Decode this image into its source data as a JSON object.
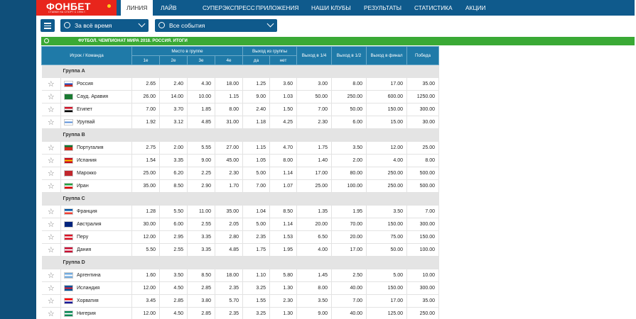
{
  "logo": {
    "text": "ФОНБЕТ",
    "tagline": "СТАВКИ НА СПОРТ С 1994 Г."
  },
  "nav": [
    "ЛИНИЯ",
    "ЛАЙВ",
    "СУПЕРЭКСПРЕСС",
    "ПРИЛОЖЕНИЯ",
    "НАШИ КЛУБЫ",
    "РЕЗУЛЬТАТЫ",
    "СТАТИСТИКА",
    "АКЦИИ"
  ],
  "filters": {
    "period": "За всё время",
    "events": "Все события"
  },
  "tournament": "ФУТБОЛ. ЧЕМПИОНАТ МИРА 2018. РОССИЯ. ИТОГИ",
  "table": {
    "headers": {
      "team": "Игрок / Команда",
      "place": "Место в группе",
      "place_cols": [
        "1е",
        "2е",
        "3е",
        "4е"
      ],
      "exit": "Выход из группы",
      "exit_cols": [
        "да",
        "нет"
      ],
      "q14": "Выход в 1/4",
      "q12": "Выход в 1/2",
      "final": "Выход в финал",
      "win": "Победа"
    },
    "groups": [
      {
        "name": "Группа A",
        "teams": [
          {
            "name": "Россия",
            "flag": [
              "#ffffff",
              "#1b4fc4",
              "#d52b1e"
            ],
            "odds": [
              "2.65",
              "2.40",
              "4.30",
              "18.00",
              "1.25",
              "3.60",
              "3.00",
              "8.00",
              "17.00",
              "35.00"
            ]
          },
          {
            "name": "Сауд. Аравия",
            "flag": [
              "#1a7a32",
              "#1a7a32",
              "#1a7a32"
            ],
            "odds": [
              "26.00",
              "14.00",
              "10.00",
              "1.15",
              "9.00",
              "1.03",
              "50.00",
              "250.00",
              "600.00",
              "1250.00"
            ]
          },
          {
            "name": "Египет",
            "flag": [
              "#ce1126",
              "#ffffff",
              "#000000"
            ],
            "odds": [
              "7.00",
              "3.70",
              "1.85",
              "8.00",
              "2.40",
              "1.50",
              "7.00",
              "50.00",
              "150.00",
              "300.00"
            ]
          },
          {
            "name": "Уругвай",
            "flag": [
              "#ffffff",
              "#5a8fd8",
              "#ffffff"
            ],
            "odds": [
              "1.92",
              "3.12",
              "4.85",
              "31.00",
              "1.18",
              "4.25",
              "2.30",
              "6.00",
              "15.00",
              "30.00"
            ]
          }
        ]
      },
      {
        "name": "Группа B",
        "teams": [
          {
            "name": "Португалия",
            "flag": [
              "#0a7a32",
              "#d52b1e",
              "#d52b1e"
            ],
            "odds": [
              "2.75",
              "2.00",
              "5.55",
              "27.00",
              "1.15",
              "4.70",
              "1.75",
              "3.50",
              "12.00",
              "25.00"
            ]
          },
          {
            "name": "Испания",
            "flag": [
              "#c60b1e",
              "#ffc400",
              "#c60b1e"
            ],
            "odds": [
              "1.54",
              "3.35",
              "9.00",
              "45.00",
              "1.05",
              "8.00",
              "1.40",
              "2.00",
              "4.00",
              "8.00"
            ]
          },
          {
            "name": "Марокко",
            "flag": [
              "#c1272d",
              "#c1272d",
              "#c1272d"
            ],
            "odds": [
              "25.00",
              "6.20",
              "2.25",
              "2.30",
              "5.00",
              "1.14",
              "17.00",
              "80.00",
              "250.00",
              "500.00"
            ]
          },
          {
            "name": "Иран",
            "flag": [
              "#239f40",
              "#ffffff",
              "#da0000"
            ],
            "odds": [
              "35.00",
              "8.50",
              "2.90",
              "1.70",
              "7.00",
              "1.07",
              "25.00",
              "100.00",
              "250.00",
              "500.00"
            ]
          }
        ]
      },
      {
        "name": "Группа C",
        "teams": [
          {
            "name": "Франция",
            "flag": [
              "#0055a4",
              "#ffffff",
              "#ef4135"
            ],
            "odds": [
              "1.28",
              "5.50",
              "11.00",
              "35.00",
              "1.04",
              "8.50",
              "1.35",
              "1.95",
              "3.50",
              "7.00"
            ]
          },
          {
            "name": "Австралия",
            "flag": [
              "#00247d",
              "#00247d",
              "#00247d"
            ],
            "odds": [
              "30.00",
              "6.00",
              "2.55",
              "2.05",
              "5.00",
              "1.14",
              "20.00",
              "70.00",
              "150.00",
              "300.00"
            ]
          },
          {
            "name": "Перу",
            "flag": [
              "#d91023",
              "#ffffff",
              "#d91023"
            ],
            "odds": [
              "12.00",
              "2.95",
              "3.35",
              "2.80",
              "2.35",
              "1.53",
              "6.50",
              "20.00",
              "75.00",
              "150.00"
            ]
          },
          {
            "name": "Дания",
            "flag": [
              "#c60c30",
              "#ffffff",
              "#c60c30"
            ],
            "odds": [
              "5.50",
              "2.55",
              "3.35",
              "4.85",
              "1.75",
              "1.95",
              "4.00",
              "17.00",
              "50.00",
              "100.00"
            ]
          }
        ]
      },
      {
        "name": "Группа D",
        "teams": [
          {
            "name": "Аргентина",
            "flag": [
              "#74acdf",
              "#ffffff",
              "#74acdf"
            ],
            "odds": [
              "1.60",
              "3.50",
              "8.50",
              "18.00",
              "1.10",
              "5.80",
              "1.45",
              "2.50",
              "5.00",
              "10.00"
            ]
          },
          {
            "name": "Исландия",
            "flag": [
              "#02529c",
              "#dc1e35",
              "#02529c"
            ],
            "odds": [
              "12.00",
              "4.50",
              "2.85",
              "2.35",
              "3.25",
              "1.30",
              "8.00",
              "40.00",
              "150.00",
              "300.00"
            ]
          },
          {
            "name": "Хорватия",
            "flag": [
              "#ff0000",
              "#ffffff",
              "#171796"
            ],
            "odds": [
              "3.45",
              "2.85",
              "3.80",
              "5.70",
              "1.55",
              "2.30",
              "3.50",
              "7.00",
              "17.00",
              "35.00"
            ]
          },
          {
            "name": "Нигерия",
            "flag": [
              "#008751",
              "#ffffff",
              "#008751"
            ],
            "odds": [
              "12.00",
              "4.50",
              "2.85",
              "2.35",
              "3.25",
              "1.30",
              "9.00",
              "40.00",
              "125.00",
              "250.00"
            ]
          }
        ]
      }
    ]
  }
}
